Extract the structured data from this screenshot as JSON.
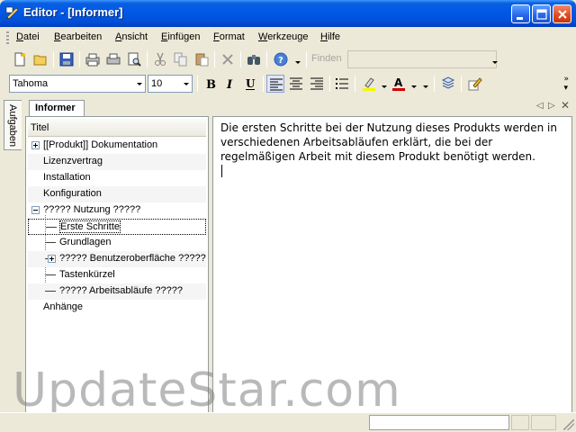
{
  "window": {
    "title": "Editor - [Informer]"
  },
  "menu": [
    "Datei",
    "Bearbeiten",
    "Ansicht",
    "Einfügen",
    "Format",
    "Werkzeuge",
    "Hilfe"
  ],
  "toolbar": {
    "find_label": "Finden",
    "find_value": ""
  },
  "format": {
    "font": "Tahoma",
    "size": "10",
    "highlight_color": "#f6f600",
    "font_color": "#d00000"
  },
  "sidebar": {
    "tab_label": "Aufgaben"
  },
  "panel": {
    "tab_label": "Informer"
  },
  "tree": {
    "header": "Titel",
    "items": [
      {
        "label": "[[Produkt]] Dokumentation"
      },
      {
        "label": "Lizenzvertrag"
      },
      {
        "label": "Installation"
      },
      {
        "label": "Konfiguration"
      },
      {
        "label": "????? Nutzung ?????"
      },
      {
        "label": "Erste Schritte"
      },
      {
        "label": "Grundlagen"
      },
      {
        "label": "????? Benutzeroberfläche ?????"
      },
      {
        "label": "Tastenkürzel"
      },
      {
        "label": "????? Arbeitsabläufe ?????"
      },
      {
        "label": "Anhänge"
      }
    ]
  },
  "editor": {
    "text": "Die ersten Schritte bei der Nutzung dieses Produkts werden in verschiedenen Arbeitsabläufen erklärt, die bei der regelmäßigen Arbeit mit diesem Produkt benötigt werden."
  },
  "watermark": "UpdateStar.com"
}
